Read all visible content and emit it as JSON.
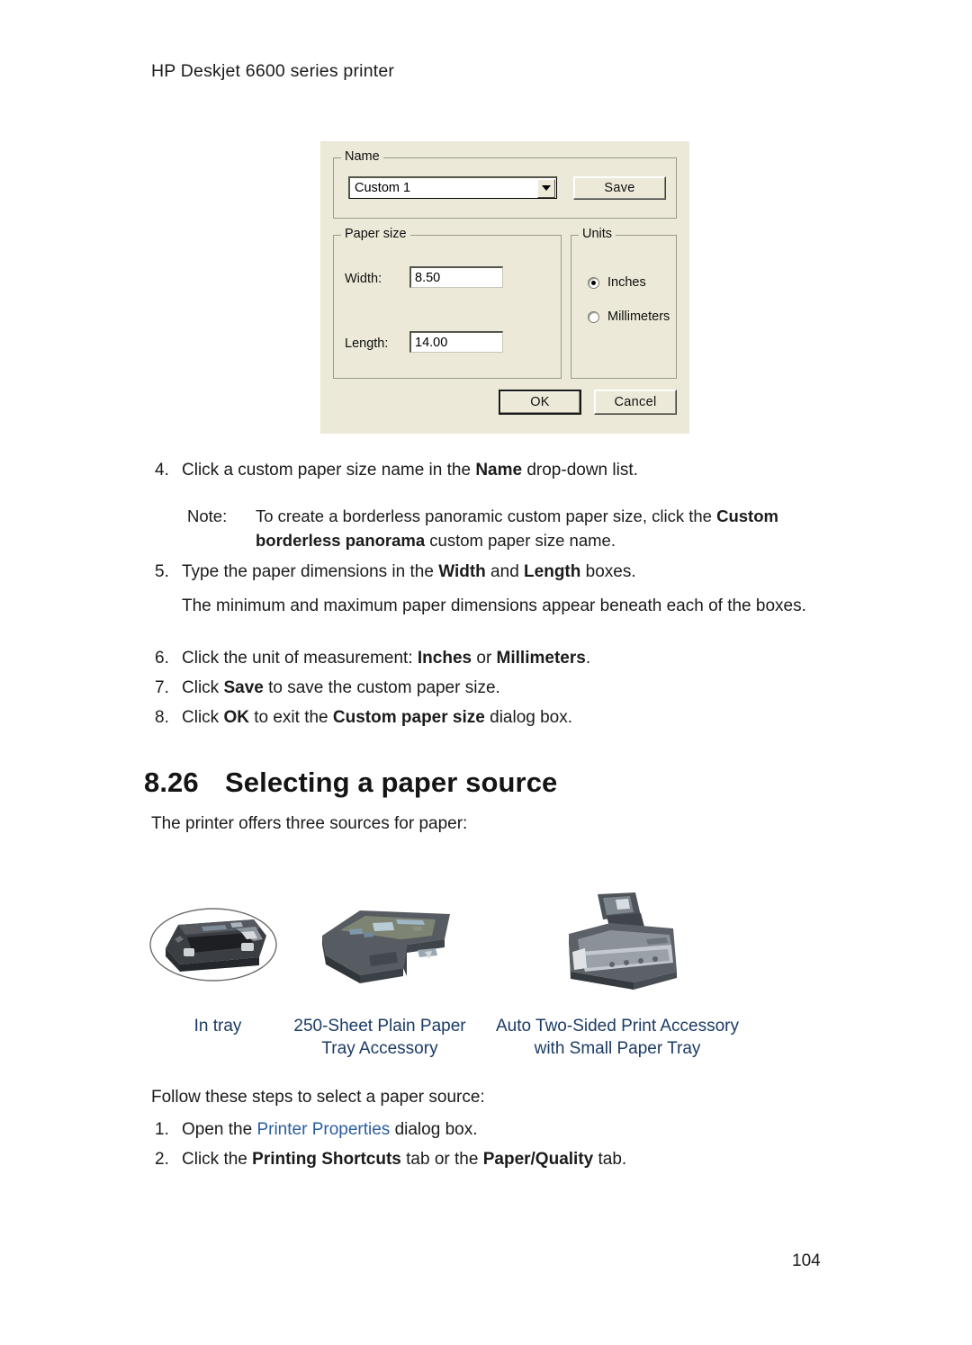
{
  "header": {
    "running_head": "HP Deskjet 6600 series printer"
  },
  "dialog": {
    "name_group": {
      "legend": "Name",
      "combo_value": "Custom 1",
      "dropdown_icon": "chevron-down-icon",
      "save_button": "Save"
    },
    "paper_size_group": {
      "legend": "Paper size",
      "width_label": "Width:",
      "width_value": "8.50",
      "length_label": "Length:",
      "length_value": "14.00"
    },
    "units_group": {
      "legend": "Units",
      "inches_label": "Inches",
      "inches_selected": true,
      "millimeters_label": "Millimeters",
      "millimeters_selected": false
    },
    "ok_button": "OK",
    "cancel_button": "Cancel"
  },
  "steps_custom_size": {
    "step4": {
      "num": "4.",
      "pre": "Click a custom paper size name in the ",
      "bold": "Name",
      "post": " drop-down list."
    },
    "note": {
      "keyword": "Note:",
      "line1_pre": "To create a borderless panoramic custom paper size, click the ",
      "line1_bold": "Custom",
      "line2_bold": "borderless panorama",
      "line2_post": " custom paper size name."
    },
    "step5": {
      "num": "5.",
      "pre": "Type the paper dimensions in the ",
      "bold1": "Width",
      "mid": " and ",
      "bold2": "Length",
      "post": " boxes."
    },
    "step5_body": "The minimum and maximum paper dimensions appear beneath each of the boxes.",
    "step6": {
      "num": "6.",
      "pre": "Click the unit of measurement: ",
      "bold1": "Inches",
      "mid": " or ",
      "bold2": "Millimeters",
      "post": "."
    },
    "step7": {
      "num": "7.",
      "pre": "Click ",
      "bold": "Save",
      "post": " to save the custom paper size."
    },
    "step8": {
      "num": "8.",
      "pre": "Click ",
      "bold1": "OK",
      "mid": " to exit the ",
      "bold2": "Custom paper size",
      "post": " dialog box."
    }
  },
  "section": {
    "number": "8.26",
    "title": "Selecting a paper source",
    "intro": "The printer offers three sources for paper:"
  },
  "figures": [
    {
      "image_name": "in-tray-illustration",
      "caption_line1": "In tray",
      "caption_line2": ""
    },
    {
      "image_name": "250-sheet-plain-paper-tray-accessory-illustration",
      "caption_line1": "250-Sheet Plain Paper",
      "caption_line2": "Tray Accessory"
    },
    {
      "image_name": "auto-two-sided-print-accessory-illustration",
      "caption_line1": "Auto Two-Sided Print Accessory",
      "caption_line2": "with Small Paper Tray"
    }
  ],
  "steps_paper_source": {
    "intro": "Follow these steps to select a paper source:",
    "step1": {
      "num": "1.",
      "pre": "Open the ",
      "link": "Printer Properties",
      "post": " dialog box."
    },
    "step2": {
      "num": "2.",
      "pre": "Click the ",
      "bold1": "Printing Shortcuts",
      "mid": " tab or the ",
      "bold2": "Paper/Quality",
      "post": " tab."
    }
  },
  "footer": {
    "page_number": "104"
  },
  "colors": {
    "caption_blue": "#1b3b64",
    "link_blue": "#2a5d9e",
    "dialog_face": "#ece9d8"
  }
}
